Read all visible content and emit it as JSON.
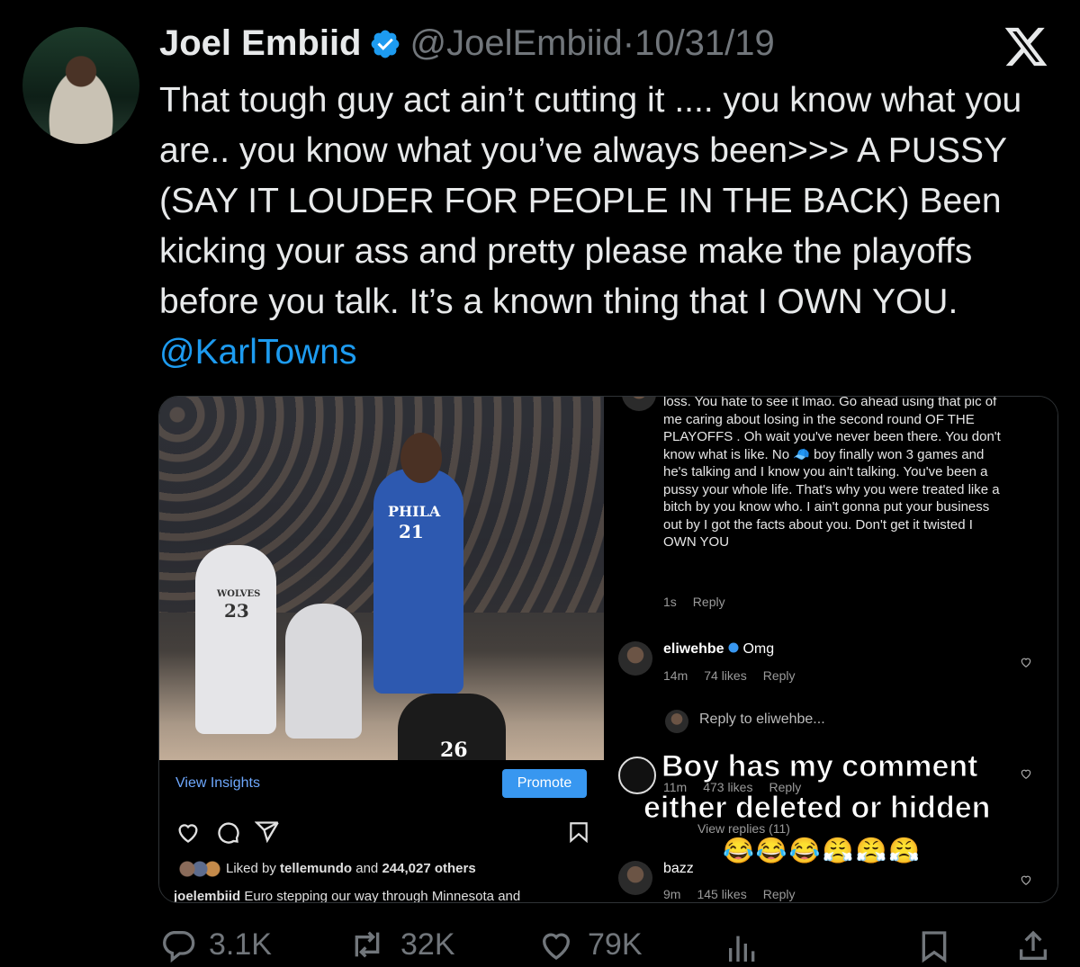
{
  "tweet": {
    "author_name": "Joel Embiid",
    "handle": "@JoelEmbiid",
    "separator": "·",
    "date": "10/31/19",
    "text": "That tough guy act ain’t cutting it .... you know what you are.. you know what you’ve always been>>> A PUSSY  (SAY IT LOUDER FOR PEOPLE IN THE BACK) Been kicking your ass and pretty please make the playoffs before you talk. It’s a known thing that I OWN YOU. ",
    "mention": "@KarlTowns",
    "icons": {
      "verified": "verified-badge-icon",
      "brand": "x-logo-icon"
    },
    "accent_color": "#1d9bf0"
  },
  "media": {
    "left": {
      "jersey_phila": "PHILA",
      "jersey_number": "21",
      "wolves_label": "WOLVES",
      "wolves_number": "23",
      "ref_number": "26",
      "view_insights": "View Insights",
      "promote": "Promote",
      "liked_prefix": "Liked by ",
      "liked_user": "tellemundo",
      "liked_suffix": " and ",
      "liked_others": "244,027 others",
      "caption_user": "joelembiid",
      "caption_text": " Euro stepping our way through Minnesota and"
    },
    "right": {
      "comment_text": "loss. You hate to see it lmao. Go ahead using that pic of me caring about losing in the second round OF THE PLAYOFFS . Oh wait you've never been there. You don't know what is like. No 🧢 boy finally won 3 games and he's talking and I know you ain't talking. You've been a pussy your whole life. That's why you were treated like a bitch by you know who. I ain't gonna put your business out by I got the facts about you. Don't get it twisted I OWN YOU",
      "comment_time": "1s",
      "comment_reply": "Reply",
      "c1_user": "eliwehbe",
      "c1_text": "Omg",
      "c1_time": "14m",
      "c1_likes": "74 likes",
      "c1_reply": "Reply",
      "reply_to": "Reply to eliwehbe...",
      "c2_time": "11m",
      "c2_likes": "473 likes",
      "c2_reply": "Reply",
      "overlay_line1": "Boy has my comment",
      "overlay_line2": "either deleted or hidden",
      "view_replies": "View replies (11)",
      "emojis": "😂😂😂😤😤😤",
      "c3_user": "bazz",
      "c3_time": "9m",
      "c3_likes": "145 likes",
      "c3_reply": "Reply"
    }
  },
  "actions": {
    "replies": "3.1K",
    "reposts": "32K",
    "likes": "79K",
    "icons": [
      "reply-icon",
      "repost-icon",
      "like-icon",
      "views-icon",
      "bookmark-icon",
      "share-icon"
    ]
  }
}
